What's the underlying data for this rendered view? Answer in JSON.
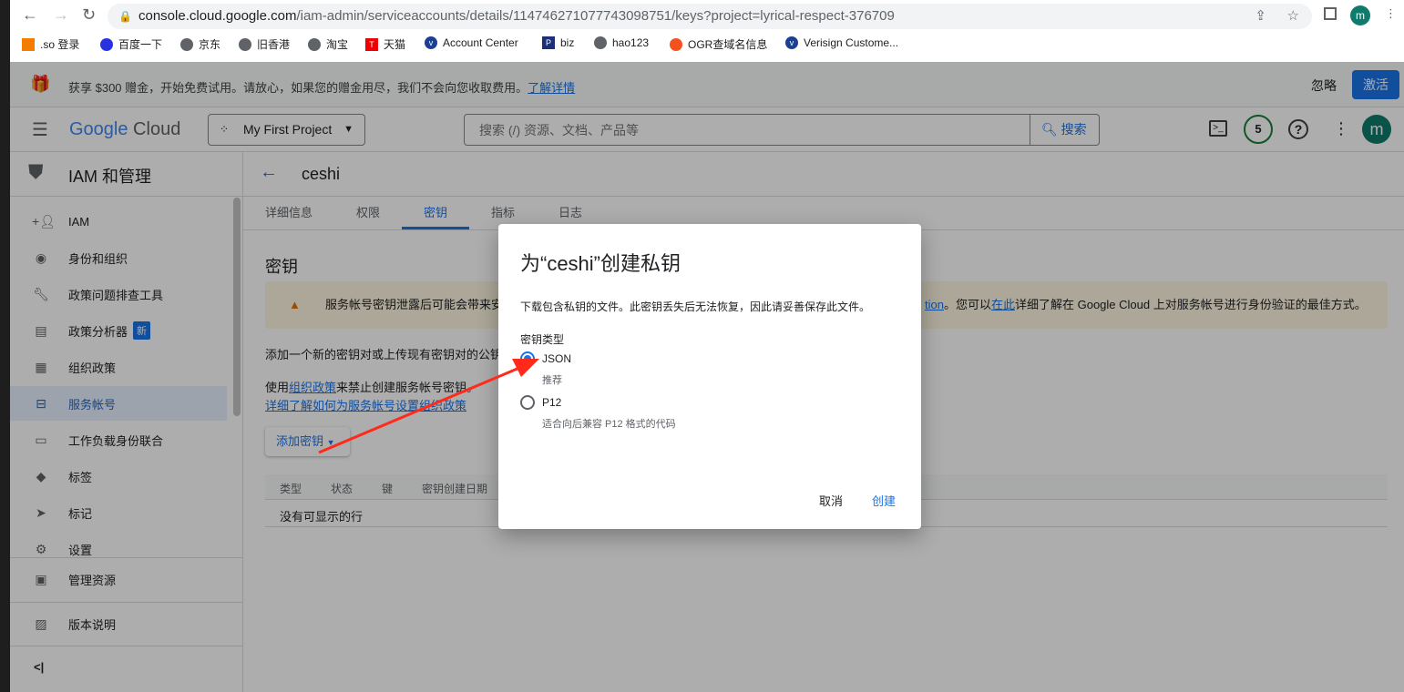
{
  "browser": {
    "url_host": "console.cloud.google.com",
    "url_path": "/iam-admin/serviceaccounts/details/114746271077743098751/keys?project=lyrical-respect-376709",
    "profile_initial": "m",
    "bookmarks": [
      ".so 登录",
      "百度一下",
      "京东",
      "旧香港",
      "淘宝",
      "天猫",
      "Account Center",
      "biz",
      "hao123",
      "OGR查域名信息",
      "Verisign Custome..."
    ]
  },
  "banner": {
    "text": "获享 $300 赠金，开始免费试用。请放心，如果您的赠金用尽，我们不会向您收取费用。",
    "link": "了解详情",
    "dismiss": "忽略",
    "activate": "激活"
  },
  "header": {
    "logo_google": "Google",
    "logo_cloud": " Cloud",
    "project": "My First Project",
    "search_placeholder": "搜索 (/) 资源、文档、产品等",
    "search_button": "搜索",
    "notifications": "5",
    "avatar": "m"
  },
  "sidebar": {
    "title": "IAM 和管理",
    "items": [
      {
        "label": "IAM",
        "icon": "person-add-icon"
      },
      {
        "label": "身份和组织",
        "icon": "account-circle-icon"
      },
      {
        "label": "政策问题排查工具",
        "icon": "wrench-icon"
      },
      {
        "label": "政策分析器",
        "icon": "policy-analyzer-icon",
        "badge": "新"
      },
      {
        "label": "组织政策",
        "icon": "list-icon"
      },
      {
        "label": "服务帐号",
        "icon": "service-account-icon"
      },
      {
        "label": "工作负载身份联合",
        "icon": "id-card-icon"
      },
      {
        "label": "标签",
        "icon": "tag-icon"
      },
      {
        "label": "标记",
        "icon": "label-icon"
      },
      {
        "label": "设置",
        "icon": "gear-icon"
      }
    ],
    "bottom": [
      {
        "label": "管理资源",
        "icon": "folder-gear-icon"
      },
      {
        "label": "版本说明",
        "icon": "notes-icon"
      }
    ],
    "collapse": "<|"
  },
  "main": {
    "title": "ceshi",
    "tabs": [
      "详细信息",
      "权限",
      "密钥",
      "指标",
      "日志"
    ],
    "active_tab": "密钥",
    "section_title": "密钥",
    "warning_start": "服务帐号密钥泄露后可能会带来安",
    "warning_link1": "tion",
    "warning_mid": "。您可以",
    "warning_link2": "在此",
    "warning_end": "详细了解在 Google Cloud 上对服务帐号进行身份验证的最佳方式。",
    "desc": "添加一个新的密钥对或上传现有密钥对的公钥",
    "policy_pre": "使用",
    "policy_link": "组织政策",
    "policy_post": "来禁止创建服务帐号密钥。",
    "learn_link": "详细了解如何为服务帐号设置组织政策",
    "add_key": "添加密钥",
    "columns": [
      "类型",
      "状态",
      "键",
      "密钥创建日期"
    ],
    "empty": "没有可显示的行"
  },
  "dialog": {
    "title": "为“ceshi”创建私钥",
    "desc": "下载包含私钥的文件。此密钥丢失后无法恢复，因此请妥善保存此文件。",
    "key_type_label": "密钥类型",
    "options": [
      {
        "label": "JSON",
        "hint": "推荐",
        "selected": true
      },
      {
        "label": "P12",
        "hint": "适合向后兼容 P12 格式的代码",
        "selected": false
      }
    ],
    "cancel": "取消",
    "create": "创建"
  },
  "colors": {
    "accent": "#1a73e8",
    "annotation_arrow": "#ff2a1a",
    "activate_button": "#1a73e8"
  }
}
